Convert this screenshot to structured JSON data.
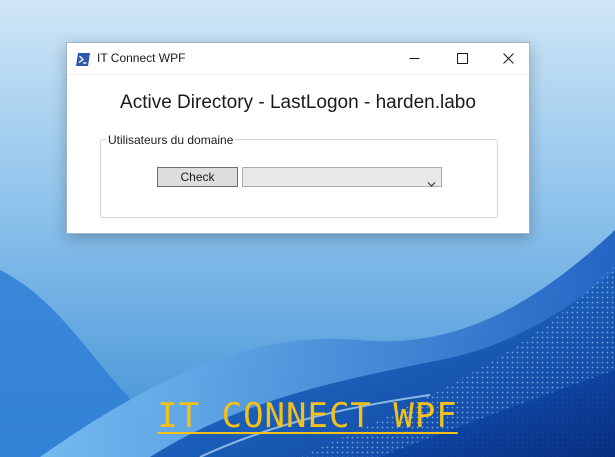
{
  "window": {
    "title": "IT Connect WPF",
    "heading": "Active Directory - LastLogon - harden.labo",
    "title_icon": "powershell-icon",
    "controls": {
      "minimize_icon": "minimize-icon",
      "maximize_icon": "maximize-icon",
      "close_icon": "close-icon"
    },
    "groupbox": {
      "label": "Utilisateurs du domaine",
      "check_button_label": "Check",
      "combo_value": "",
      "combo_icon": "chevron-down-icon"
    }
  },
  "banner": {
    "text": "IT CONNECT WPF",
    "color": "#f2c21b"
  },
  "colors": {
    "accent": "#0067c0",
    "button_face": "#dddddd",
    "wallpaper_light": "#cfe3f5",
    "wallpaper_dark": "#0a3d91"
  }
}
